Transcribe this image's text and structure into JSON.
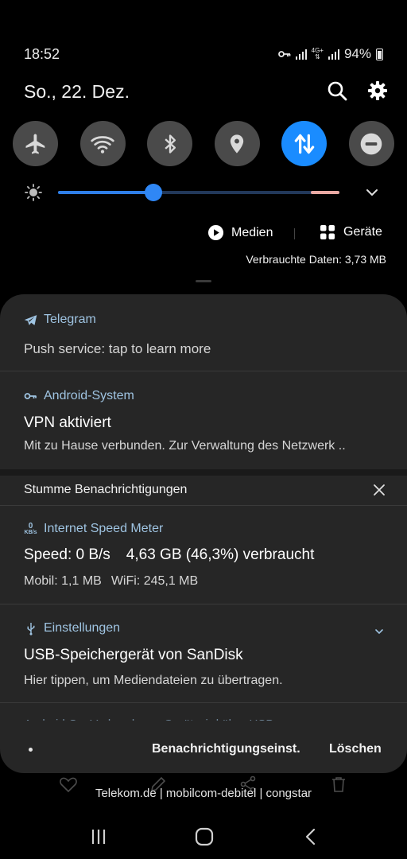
{
  "status_bar": {
    "time": "18:52",
    "network_label": "4G+",
    "battery": "94%",
    "battery_level": 0.94,
    "icons": [
      "vpn-key-icon",
      "signal-icon",
      "lte-icon",
      "signal-icon",
      "battery-icon"
    ]
  },
  "header": {
    "date": "So., 22. Dez.",
    "search_icon": "search-icon",
    "settings_icon": "gear-icon"
  },
  "quick_settings": [
    {
      "name": "airplane",
      "icon": "airplane-icon",
      "active": false
    },
    {
      "name": "wifi",
      "icon": "wifi-icon",
      "active": false
    },
    {
      "name": "bluetooth",
      "icon": "bluetooth-icon",
      "active": false
    },
    {
      "name": "location",
      "icon": "location-icon",
      "active": false
    },
    {
      "name": "mobile-data",
      "icon": "data-transfer-icon",
      "active": true
    },
    {
      "name": "do-not-disturb",
      "icon": "minus-circle-icon",
      "active": false
    }
  ],
  "brightness": {
    "level": 0.34,
    "accent": "#2f87f5"
  },
  "media": {
    "media_label": "Medien",
    "devices_label": "Geräte",
    "data_used": "Verbrauchte Daten: 3,73 MB"
  },
  "notifications": {
    "telegram": {
      "app": "Telegram",
      "text": "Push service: tap to learn more"
    },
    "android_system": {
      "app": "Android-System",
      "title": "VPN aktiviert",
      "text": "Mit zu Hause verbunden. Zur Verwaltung des Netzwerk .."
    },
    "silent_header": "Stumme Benachrichtigungen",
    "speed_meter": {
      "app": "Internet Speed Meter",
      "icon_value": "0",
      "icon_unit": "KB/s",
      "title_speed": "Speed: 0 B/s",
      "title_usage": "4,63 GB (46,3%) verbraucht",
      "mobile": "Mobil: 1,1 MB",
      "wifi": "WiFi: 245,1 MB"
    },
    "settings": {
      "app": "Einstellungen",
      "title": "USB-Speichergerät von SanDisk",
      "text": "Hier tippen, um Mediendateien zu übertragen."
    },
    "peek_text": "Android-S...   Verbundenes Gerät wird über USB au..."
  },
  "footer": {
    "settings_label": "Benachrichtigungseinst.",
    "clear_label": "Löschen"
  },
  "carrier": "Telekom.de | mobilcom-debitel | congstar",
  "navbar": {
    "recents": "recents-icon",
    "home": "home-icon",
    "back": "back-icon"
  }
}
